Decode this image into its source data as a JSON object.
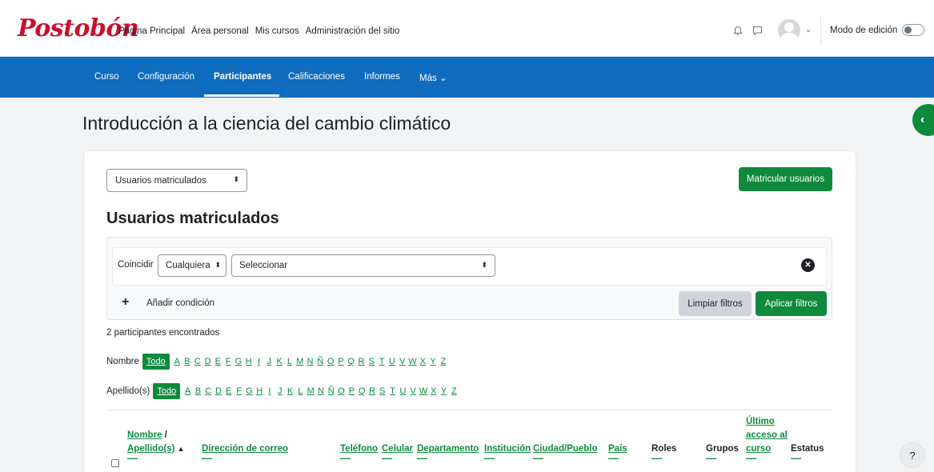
{
  "brand": {
    "logo_text": "Postobón",
    "logo_color": "#c8102e",
    "accent": "#0f8a3c",
    "nav_color": "#0f6cbf"
  },
  "primary_nav": [
    "Página Principal",
    "Área personal",
    "Mis cursos",
    "Administración del sitio"
  ],
  "header_tools": {
    "notifications_icon": "bell-icon",
    "messages_icon": "chat-icon",
    "edit_mode_label": "Modo de edición"
  },
  "secondary_nav": {
    "items": [
      {
        "label": "Curso"
      },
      {
        "label": "Configuración"
      },
      {
        "label": "Participantes",
        "active": true
      },
      {
        "label": "Calificaciones"
      },
      {
        "label": "Informes"
      },
      {
        "label": "Más"
      }
    ]
  },
  "page": {
    "title": "Introducción a la ciencia del cambio climático"
  },
  "participants": {
    "view_select_value": "Usuarios matriculados",
    "enrol_button": "Matricular usuarios",
    "heading": "Usuarios matriculados",
    "filter": {
      "match_label": "Coincidir",
      "match_value": "Cualquiera",
      "condition_value": "Seleccionar",
      "add_condition": "Añadir condición",
      "clear_button": "Limpiar filtros",
      "apply_button": "Aplicar filtros"
    },
    "found_text": "2 participantes encontrados",
    "initials_first": {
      "label": "Nombre",
      "all": "Todo"
    },
    "initials_last": {
      "label": "Apellido(s)",
      "all": "Todo"
    },
    "letters": [
      "A",
      "B",
      "C",
      "D",
      "E",
      "F",
      "G",
      "H",
      "I",
      "J",
      "K",
      "L",
      "M",
      "N",
      "Ñ",
      "O",
      "P",
      "Q",
      "R",
      "S",
      "T",
      "U",
      "V",
      "W",
      "X",
      "Y",
      "Z"
    ],
    "columns": {
      "first_name": "Nombre",
      "slash": " /",
      "last_name": "Apellido(s)",
      "email": "Dirección de correo",
      "phone": "Teléfono",
      "mobile": "Celular",
      "department": "Departamento",
      "institution": "Institución",
      "city": "Ciudad/Pueblo",
      "country": "País",
      "roles": "Roles",
      "groups": "Grupos",
      "last_access_1": "Último",
      "last_access_2": "acceso al",
      "last_access_3": "curso",
      "status": "Estatus",
      "dash": "—"
    }
  },
  "help": "?"
}
